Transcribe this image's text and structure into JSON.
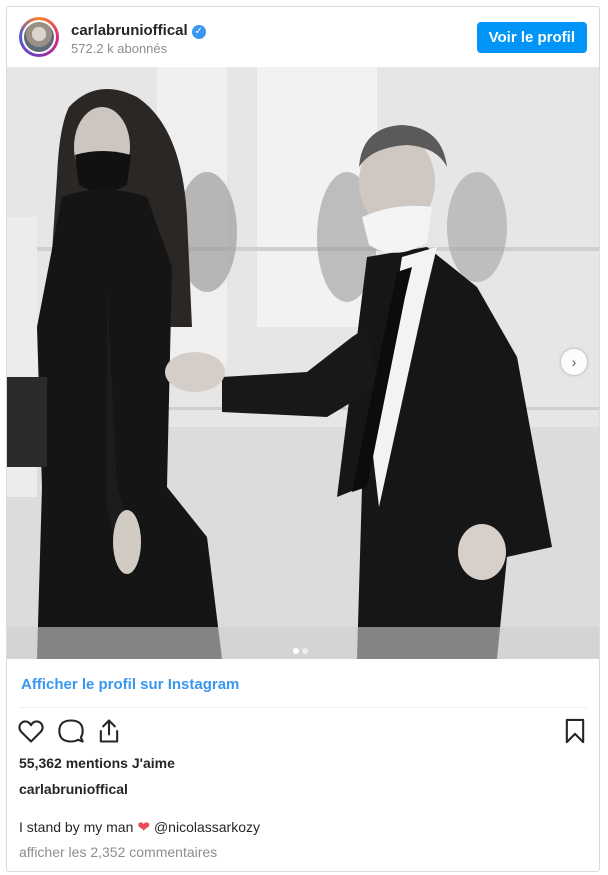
{
  "header": {
    "username": "carlabrunioffical",
    "followers": "572.2 k abonnés",
    "view_profile_label": "Voir le profil"
  },
  "post": {
    "view_on_instagram_label": "Afficher le profil sur Instagram",
    "likes": "55,362 mentions J'aime",
    "caption_user": "carlabrunioffical",
    "caption_text": "I stand by my man",
    "caption_heart": "❤",
    "caption_mention": "@nicolassarkozy",
    "view_comments": "afficher les 2,352 commentaires",
    "carousel": {
      "current": 1,
      "total": 2
    }
  },
  "icons": [
    "verified-badge-icon",
    "next-arrow-icon",
    "heart-icon",
    "comment-icon",
    "share-icon",
    "bookmark-icon"
  ],
  "colors": {
    "accent": "#0095f6",
    "link": "#3897f0",
    "heart": "#ed4956",
    "muted": "#8e8e8e"
  }
}
